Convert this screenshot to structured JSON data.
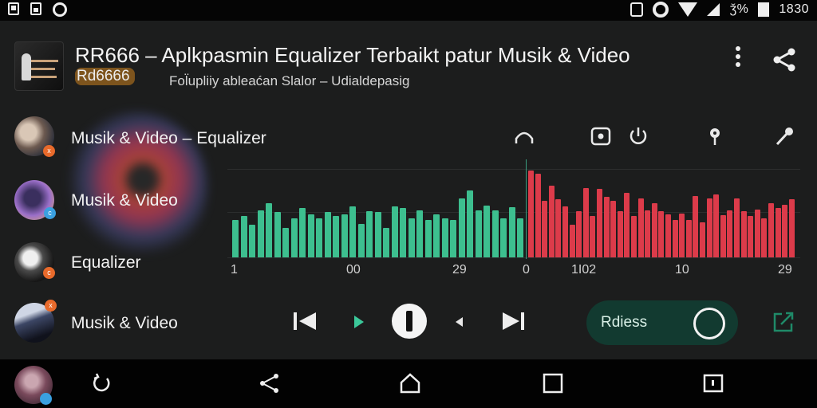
{
  "status_bar": {
    "left_icons": [
      "notification-icon",
      "photo-icon",
      "sync-icon"
    ],
    "right_icons": [
      "alarm-icon",
      "ring-icon",
      "wifi-icon",
      "signal-icon",
      "battery-icon"
    ],
    "signal_text": "ǯ%",
    "time": "1830"
  },
  "header": {
    "title": "RR666 – Aplkpasmin Equalizer Terbaikt patur Musik & Video",
    "code": "Rd6666",
    "subtitle": "Fol̈upliiy ableaćan Slalor – Udialdepasig",
    "more_icon": "more-vert-icon",
    "share_icon": "share-icon"
  },
  "list": {
    "items": [
      {
        "label": "Musik & Video – Equalizer",
        "badge": "x",
        "badge_color": "#e86a2b"
      },
      {
        "label": "Musik & Video",
        "badge": "c",
        "badge_color": "#3aa0e0"
      },
      {
        "label": "Equalizer",
        "badge": "c",
        "badge_color": "#e86a2b"
      },
      {
        "label": "Musik & Video",
        "badge": "x",
        "badge_color": "#e86a2b"
      }
    ]
  },
  "toolbar": {
    "icons": [
      "headphones-icon",
      "record-icon",
      "power-icon",
      "pin-icon",
      "microphone-icon"
    ]
  },
  "equalizer": {
    "green_color": "#3dbf8f",
    "red_color": "#dc3b4a",
    "green_levels": [
      0.38,
      0.42,
      0.33,
      0.48,
      0.55,
      0.46,
      0.3,
      0.4,
      0.5,
      0.44,
      0.4,
      0.46,
      0.42,
      0.44,
      0.52,
      0.34,
      0.47,
      0.46,
      0.3,
      0.52,
      0.5,
      0.4,
      0.48,
      0.38,
      0.44,
      0.4,
      0.38,
      0.6,
      0.68,
      0.48,
      0.53,
      0.48,
      0.4,
      0.51,
      0.4
    ],
    "red_levels": [
      0.89,
      0.85,
      0.58,
      0.73,
      0.59,
      0.52,
      0.33,
      0.47,
      0.71,
      0.42,
      0.7,
      0.62,
      0.58,
      0.47,
      0.66,
      0.42,
      0.6,
      0.48,
      0.55,
      0.47,
      0.44,
      0.38,
      0.45,
      0.38,
      0.63,
      0.36,
      0.6,
      0.64,
      0.43,
      0.48,
      0.6,
      0.47,
      0.42,
      0.49,
      0.4,
      0.55,
      0.5,
      0.54,
      0.59
    ],
    "scale_labels": [
      "1",
      "00",
      "29",
      "0",
      "1I02",
      "10",
      "29"
    ]
  },
  "player": {
    "prev_icon": "skip-previous-icon",
    "play_icon": "play-icon",
    "pause_icon": "pause-icon",
    "back_icon": "back-small-icon",
    "next_icon": "skip-next-icon",
    "toggle_label": "Rdiess",
    "external_icon": "external-link-icon"
  },
  "nav": {
    "icons": [
      "refresh-icon",
      "share-icon",
      "home-icon",
      "recents-icon",
      "square-dot-icon"
    ]
  }
}
